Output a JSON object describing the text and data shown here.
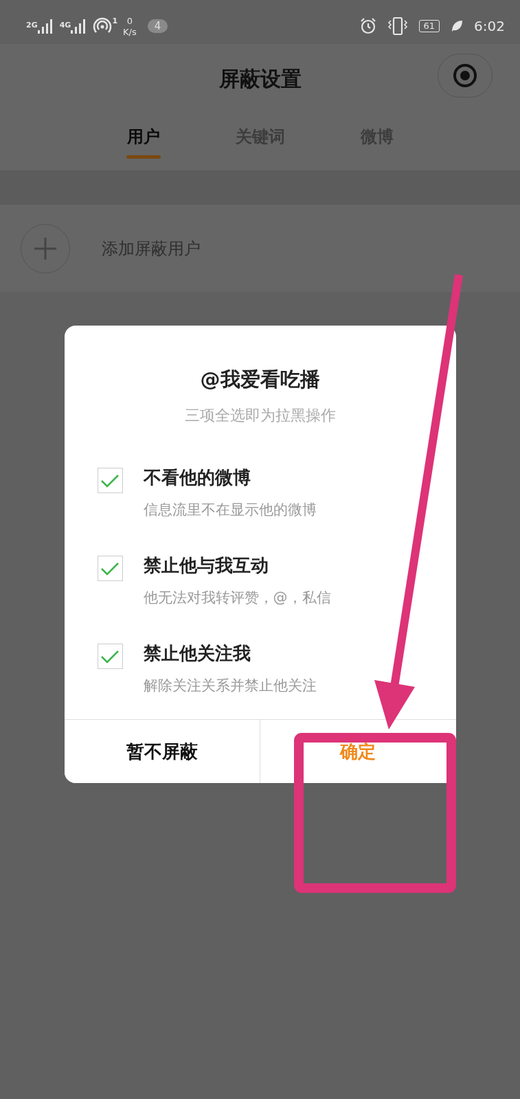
{
  "status_bar": {
    "signals": [
      "2G",
      "4G"
    ],
    "hotspot_count": "1",
    "speed_value": "0",
    "speed_unit": "K/s",
    "notification_count": "4",
    "battery": "61",
    "time": "6:02"
  },
  "header": {
    "title": "屏蔽设置"
  },
  "tabs": [
    {
      "label": "用户",
      "selected": true
    },
    {
      "label": "关键词",
      "selected": false
    },
    {
      "label": "微博",
      "selected": false
    }
  ],
  "add_row": {
    "label": "添加屏蔽用户"
  },
  "dialog": {
    "title": "@我爱看吃播",
    "subtitle": "三项全选即为拉黑操作",
    "options": [
      {
        "label": "不看他的微博",
        "description": "信息流里不在显示他的微博",
        "checked": true
      },
      {
        "label": "禁止他与我互动",
        "description": "他无法对我转评赞，@，私信",
        "checked": true
      },
      {
        "label": "禁止他关注我",
        "description": "解除关注关系并禁止他关注",
        "checked": true
      }
    ],
    "buttons": [
      {
        "label": "暂不屏蔽",
        "primary": false
      },
      {
        "label": "确定",
        "primary": true
      }
    ]
  }
}
